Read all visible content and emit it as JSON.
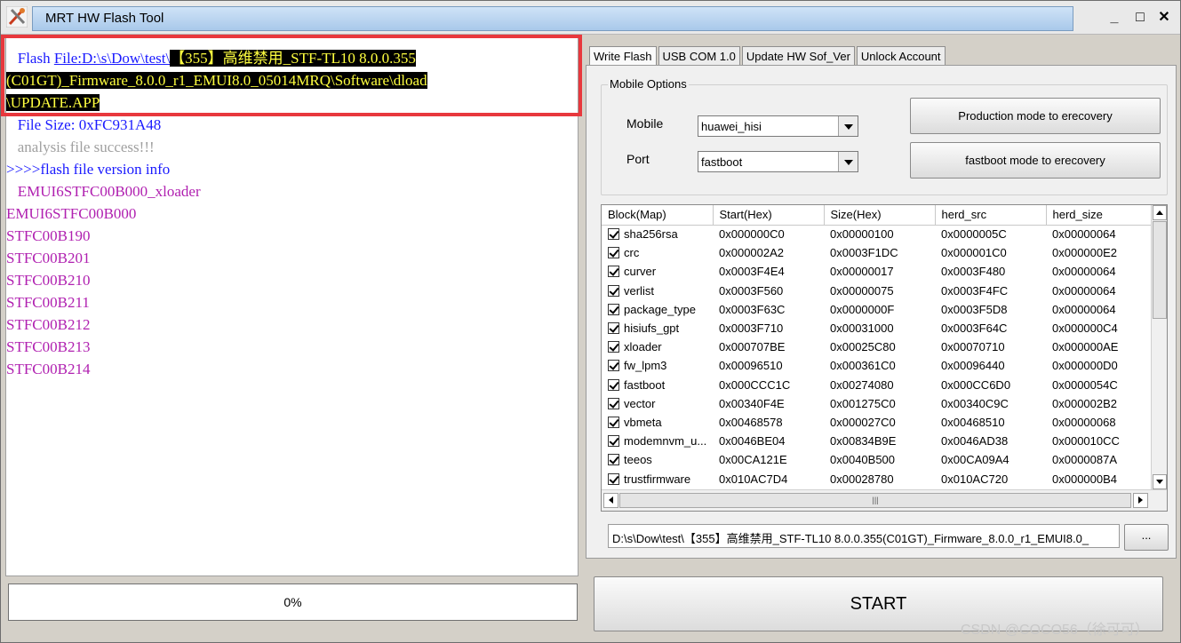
{
  "window": {
    "title": "MRT HW Flash Tool",
    "controls": {
      "minimize": "_",
      "maximize": "□",
      "close": "✕"
    }
  },
  "log": {
    "flash_prefix": "Flash ",
    "file_link": "File:D:\\s\\Dow\\test\\",
    "file_rest_line1": "【355】高维禁用_STF-TL10 8.0.0.355",
    "file_rest_line2": "(C01GT)_Firmware_8.0.0_r1_EMUI8.0_05014MRQ\\Software\\dload",
    "file_rest_line3": "\\UPDATE.APP",
    "file_size": "   File Size: 0xFC931A48",
    "analysis": "   analysis file success!!!",
    "version_header": ">>>>flash file version info",
    "version_first": "   EMUI6STFC00B000_xloader",
    "versions": [
      "EMUI6STFC00B000",
      "STFC00B190",
      "STFC00B201",
      "STFC00B210",
      "STFC00B211",
      "STFC00B212",
      "STFC00B213",
      "STFC00B214"
    ]
  },
  "progress": {
    "text": "0%",
    "value": 0
  },
  "tabs": [
    {
      "label": "Write Flash",
      "active": true
    },
    {
      "label": "USB COM 1.0",
      "active": false
    },
    {
      "label": "Update HW Sof_Ver",
      "active": false
    },
    {
      "label": "Unlock Account",
      "active": false
    }
  ],
  "mobile_options": {
    "legend": "Mobile Options",
    "mobile_label": "Mobile",
    "mobile_value": "huawei_hisi",
    "port_label": "Port",
    "port_value": "fastboot",
    "production_button": "Production mode to erecovery",
    "fastboot_button": "fastboot mode to erecovery"
  },
  "grid": {
    "columns": [
      "Block(Map)",
      "Start(Hex)",
      "Size(Hex)",
      "herd_src",
      "herd_size"
    ],
    "rows": [
      [
        "sha256rsa",
        "0x000000C0",
        "0x00000100",
        "0x0000005C",
        "0x00000064"
      ],
      [
        "crc",
        "0x000002A2",
        "0x0003F1DC",
        "0x000001C0",
        "0x000000E2"
      ],
      [
        "curver",
        "0x0003F4E4",
        "0x00000017",
        "0x0003F480",
        "0x00000064"
      ],
      [
        "verlist",
        "0x0003F560",
        "0x00000075",
        "0x0003F4FC",
        "0x00000064"
      ],
      [
        "package_type",
        "0x0003F63C",
        "0x0000000F",
        "0x0003F5D8",
        "0x00000064"
      ],
      [
        "hisiufs_gpt",
        "0x0003F710",
        "0x00031000",
        "0x0003F64C",
        "0x000000C4"
      ],
      [
        "xloader",
        "0x000707BE",
        "0x00025C80",
        "0x00070710",
        "0x000000AE"
      ],
      [
        "fw_lpm3",
        "0x00096510",
        "0x000361C0",
        "0x00096440",
        "0x000000D0"
      ],
      [
        "fastboot",
        "0x000CCC1C",
        "0x00274080",
        "0x000CC6D0",
        "0x0000054C"
      ],
      [
        "vector",
        "0x00340F4E",
        "0x001275C0",
        "0x00340C9C",
        "0x000002B2"
      ],
      [
        "vbmeta",
        "0x00468578",
        "0x000027C0",
        "0x00468510",
        "0x00000068"
      ],
      [
        "modemnvm_u...",
        "0x0046BE04",
        "0x00834B9E",
        "0x0046AD38",
        "0x000010CC"
      ],
      [
        "teeos",
        "0x00CA121E",
        "0x0040B500",
        "0x00CA09A4",
        "0x0000087A"
      ],
      [
        "trustfirmware",
        "0x010AC7D4",
        "0x00028780",
        "0x010AC720",
        "0x000000B4"
      ]
    ]
  },
  "path_field": "D:\\s\\Dow\\test\\【355】高维禁用_STF-TL10 8.0.0.355(C01GT)_Firmware_8.0.0_r1_EMUI8.0_",
  "browse_label": "...",
  "start_label": "START",
  "watermark": "CSDN @COCO56（徐可可）"
}
